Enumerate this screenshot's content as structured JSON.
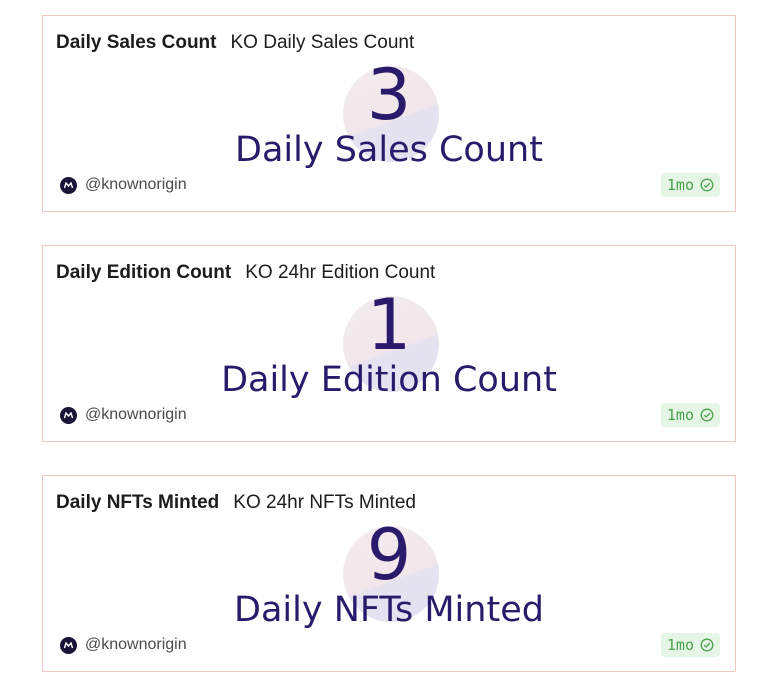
{
  "cards": [
    {
      "title": "Daily Sales Count",
      "subtitle": "KO Daily Sales Count",
      "value": "3",
      "label": "Daily Sales Count",
      "author": "@knownorigin",
      "age": "1mo"
    },
    {
      "title": "Daily Edition Count",
      "subtitle": "KO 24hr Edition Count",
      "value": "1",
      "label": "Daily Edition Count",
      "author": "@knownorigin",
      "age": "1mo"
    },
    {
      "title": "Daily NFTs Minted",
      "subtitle": "KO 24hr NFTs Minted",
      "value": "9",
      "label": "Daily NFTs Minted",
      "author": "@knownorigin",
      "age": "1mo"
    }
  ],
  "icons": {
    "avatar": "knownorigin-logo-icon",
    "verified": "check-circle-icon"
  },
  "colors": {
    "accent": "#2a1a6b",
    "border": "#f0c9c4",
    "badge_bg": "#e6f6e6",
    "badge_text": "#4aa24c"
  }
}
